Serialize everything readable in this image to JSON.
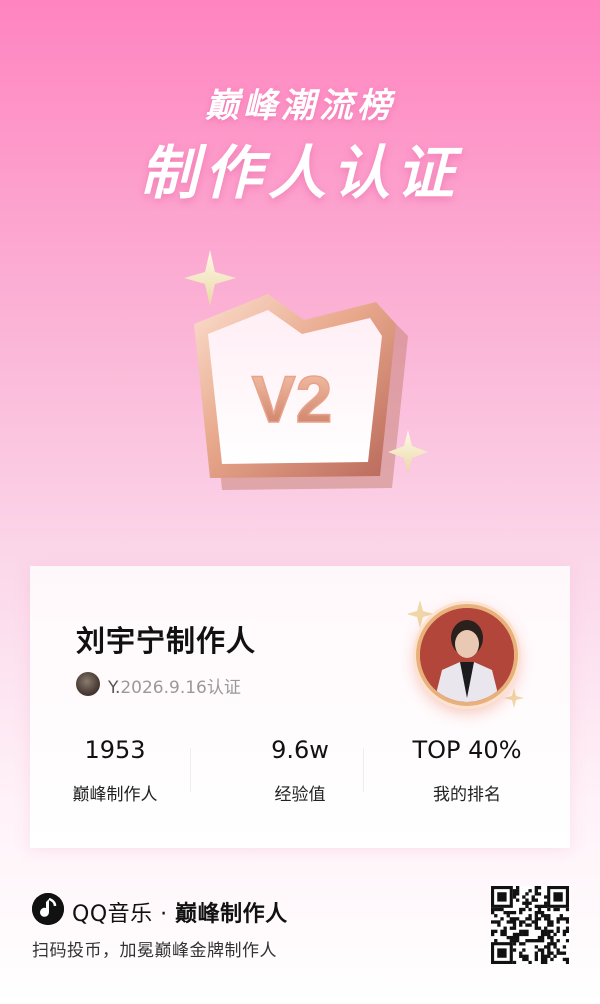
{
  "header": {
    "subtitle": "巅峰潮流榜",
    "title": "制作人认证"
  },
  "badge": {
    "level": "V2",
    "icon": "crown-badge-icon"
  },
  "card": {
    "producer_name": "刘宇宁制作人",
    "handle": "Y.",
    "cert_date_text": "2026.9.16认证",
    "stats": [
      {
        "value": "1953",
        "label": "巅峰制作人"
      },
      {
        "value": "9.6w",
        "label": "经验值"
      },
      {
        "value": "TOP 40%",
        "label": "我的排名"
      }
    ]
  },
  "footer": {
    "brand": "QQ音乐",
    "brand_separator": " · ",
    "brand_tag": "巅峰制作人",
    "slogan": "扫码投币，加冕巅峰金牌制作人",
    "logo_icon": "qq-music-logo-icon",
    "qr_icon": "qr-code-icon"
  },
  "colors": {
    "bg_top": "#ff84c0",
    "bg_bottom": "#ffffff",
    "badge_metal": "#e8a88c",
    "text_primary": "#111111",
    "text_muted": "#999999"
  }
}
